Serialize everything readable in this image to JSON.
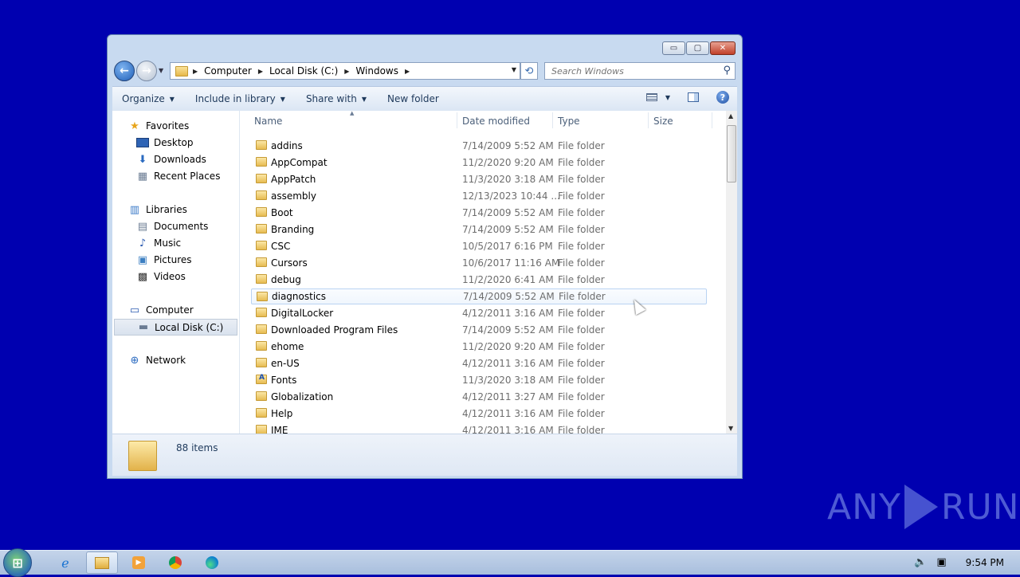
{
  "window": {
    "caption_buttons": {
      "minimize": "▭",
      "maximize": "▢",
      "close": "✕"
    }
  },
  "navbar": {
    "breadcrumb": [
      "Computer",
      "Local Disk (C:)",
      "Windows"
    ],
    "search_placeholder": "Search Windows"
  },
  "toolbar": {
    "organize": "Organize",
    "include_in_library": "Include in library",
    "share_with": "Share with",
    "new_folder": "New folder",
    "help": "?"
  },
  "navpane": {
    "favorites": "Favorites",
    "desktop": "Desktop",
    "downloads": "Downloads",
    "recent_places": "Recent Places",
    "libraries": "Libraries",
    "documents": "Documents",
    "music": "Music",
    "pictures": "Pictures",
    "videos": "Videos",
    "computer": "Computer",
    "local_disk": "Local Disk (C:)",
    "network": "Network"
  },
  "columns": {
    "name": "Name",
    "date": "Date modified",
    "type": "Type",
    "size": "Size"
  },
  "files": [
    {
      "name": "addins",
      "date": "7/14/2009 5:52 AM",
      "type": "File folder"
    },
    {
      "name": "AppCompat",
      "date": "11/2/2020 9:20 AM",
      "type": "File folder"
    },
    {
      "name": "AppPatch",
      "date": "11/3/2020 3:18 AM",
      "type": "File folder"
    },
    {
      "name": "assembly",
      "date": "12/13/2023 10:44 ...",
      "type": "File folder"
    },
    {
      "name": "Boot",
      "date": "7/14/2009 5:52 AM",
      "type": "File folder"
    },
    {
      "name": "Branding",
      "date": "7/14/2009 5:52 AM",
      "type": "File folder"
    },
    {
      "name": "CSC",
      "date": "10/5/2017 6:16 PM",
      "type": "File folder"
    },
    {
      "name": "Cursors",
      "date": "10/6/2017 11:16 AM",
      "type": "File folder"
    },
    {
      "name": "debug",
      "date": "11/2/2020 6:41 AM",
      "type": "File folder"
    },
    {
      "name": "diagnostics",
      "date": "7/14/2009 5:52 AM",
      "type": "File folder"
    },
    {
      "name": "DigitalLocker",
      "date": "4/12/2011 3:16 AM",
      "type": "File folder"
    },
    {
      "name": "Downloaded Program Files",
      "date": "7/14/2009 5:52 AM",
      "type": "File folder"
    },
    {
      "name": "ehome",
      "date": "11/2/2020 9:20 AM",
      "type": "File folder"
    },
    {
      "name": "en-US",
      "date": "4/12/2011 3:16 AM",
      "type": "File folder"
    },
    {
      "name": "Fonts",
      "date": "11/3/2020 3:18 AM",
      "type": "File folder"
    },
    {
      "name": "Globalization",
      "date": "4/12/2011 3:27 AM",
      "type": "File folder"
    },
    {
      "name": "Help",
      "date": "4/12/2011 3:16 AM",
      "type": "File folder"
    },
    {
      "name": "IME",
      "date": "4/12/2011 3:16 AM",
      "type": "File folder"
    }
  ],
  "status": {
    "item_count": "88 items"
  },
  "watermark": {
    "left": "ANY",
    "right": "RUN"
  },
  "taskbar": {
    "time": "9:54 PM"
  }
}
